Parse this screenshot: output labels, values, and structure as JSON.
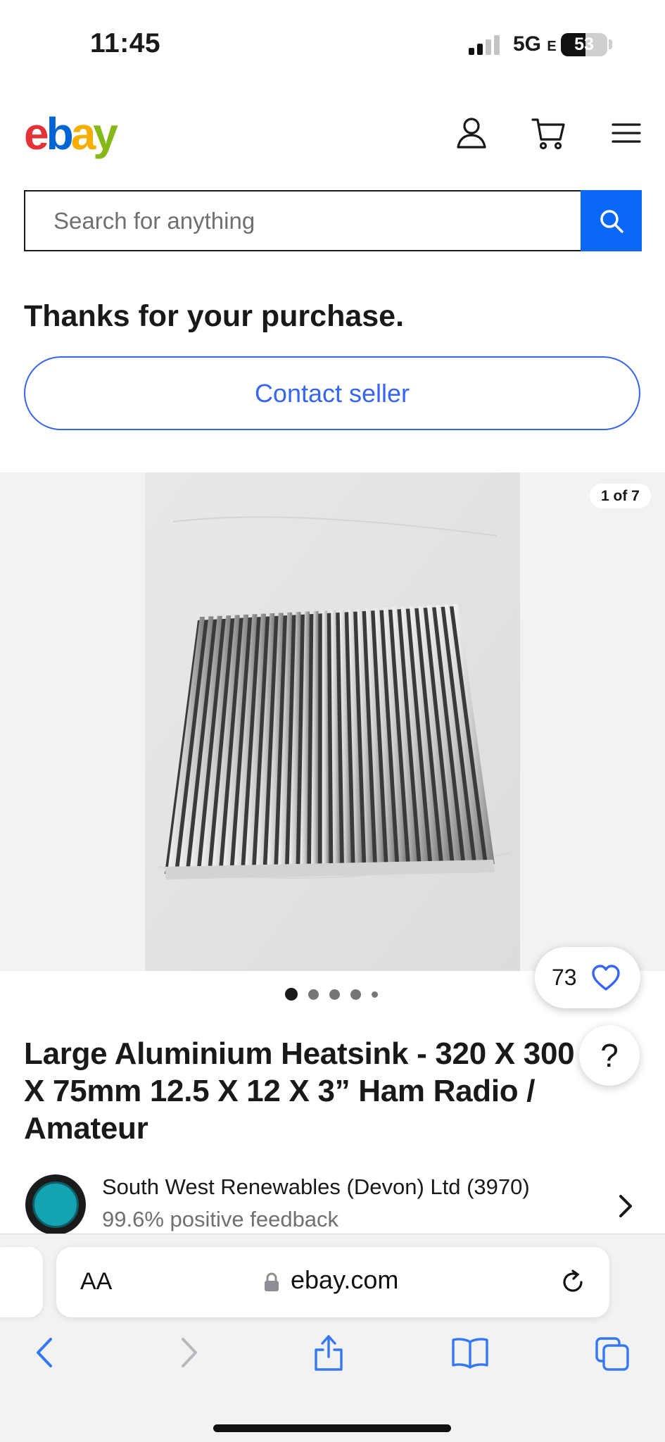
{
  "status_bar": {
    "time": "11:45",
    "network": "5G",
    "network_suffix": "E",
    "battery_percent": "53",
    "battery_level": 0.53
  },
  "header": {
    "logo": {
      "e": "e",
      "b": "b",
      "a": "a",
      "y": "y"
    },
    "icons": [
      "account-icon",
      "cart-icon",
      "menu-icon"
    ]
  },
  "search": {
    "placeholder": "Search for anything",
    "button_icon": "search-icon"
  },
  "confirmation": {
    "heading": "Thanks for your purchase.",
    "contact_label": "Contact seller"
  },
  "gallery": {
    "counter": "1 of 7",
    "watchers": "73",
    "dots": 5,
    "active_dot": 0
  },
  "help": {
    "label": "?"
  },
  "item": {
    "title": "Large Aluminium Heatsink -  320 X 300 X 75mm 12.5 X 12 X 3” Ham Radio / Amateur"
  },
  "seller": {
    "name": "South West Renewables (Devon) Ltd (3970)",
    "feedback": "99.6% positive feedback"
  },
  "browser": {
    "text_size": "AA",
    "url": "ebay.com",
    "toolbar": [
      "back-icon",
      "forward-icon",
      "share-icon",
      "bookmarks-icon",
      "tabs-icon"
    ]
  },
  "colors": {
    "accent": "#3665f3",
    "search_button": "#0968f6",
    "ebay_red": "#e53238",
    "ebay_blue": "#0064d2",
    "ebay_yellow": "#f5af02",
    "ebay_green": "#86b817"
  }
}
